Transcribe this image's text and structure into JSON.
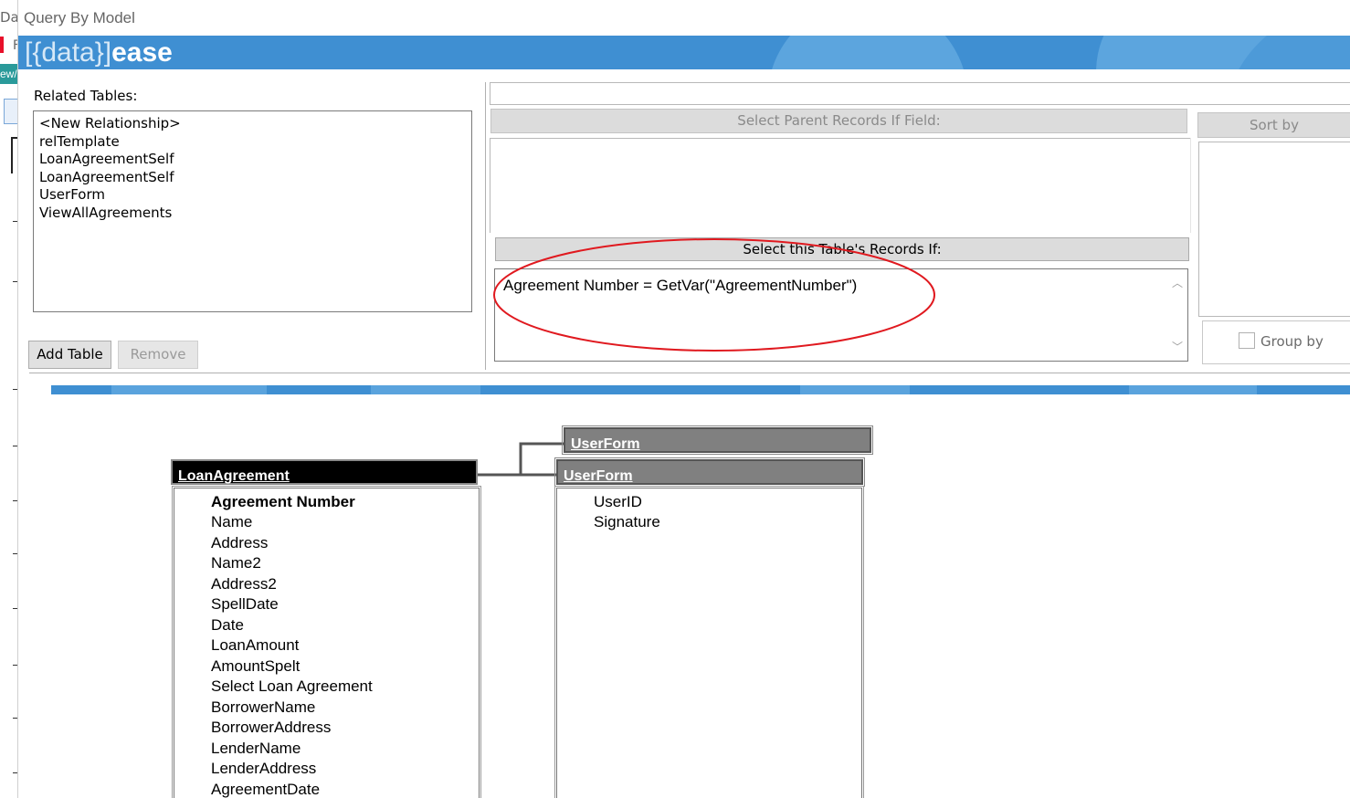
{
  "background_app": {
    "title_fragment": "Da",
    "line2_fragment": "F",
    "tab_fragment": "ew/"
  },
  "window": {
    "title": "Query By Model"
  },
  "banner": {
    "logo_thin": "[{data}]",
    "logo_bold": "ease",
    "color": "#3f8fd2"
  },
  "related_tables": {
    "label": "Related Tables:",
    "items": [
      "<New Relationship>",
      "relTemplate",
      "LoanAgreementSelf",
      "LoanAgreementSelf",
      "UserForm",
      "ViewAllAgreements"
    ],
    "add_button": "Add Table",
    "remove_button": "Remove"
  },
  "criteria": {
    "parent_header": "Select Parent Records If Field:",
    "this_header": "Select this Table's Records If:",
    "expression": "Agreement Number = GetVar(\"AgreementNumber\")",
    "annotation_color": "#e0191f"
  },
  "sort": {
    "header": "Sort by",
    "group_by": "Group by",
    "group_by_checked": false
  },
  "diagram": {
    "main_table": {
      "title": "LoanAgreement",
      "key_field": "Agreement Number",
      "fields": [
        "Name",
        "Address",
        "Name2",
        "Address2",
        "SpellDate",
        "Date",
        "LoanAmount",
        "AmountSpelt",
        "Select Loan Agreement",
        "BorrowerName",
        "BorrowerAddress",
        "LenderName",
        "LenderAddress",
        "AgreementDate"
      ]
    },
    "related_table_1": {
      "title": "UserForm"
    },
    "related_table_2": {
      "title": "UserForm",
      "fields": [
        "UserID",
        "Signature"
      ]
    }
  }
}
